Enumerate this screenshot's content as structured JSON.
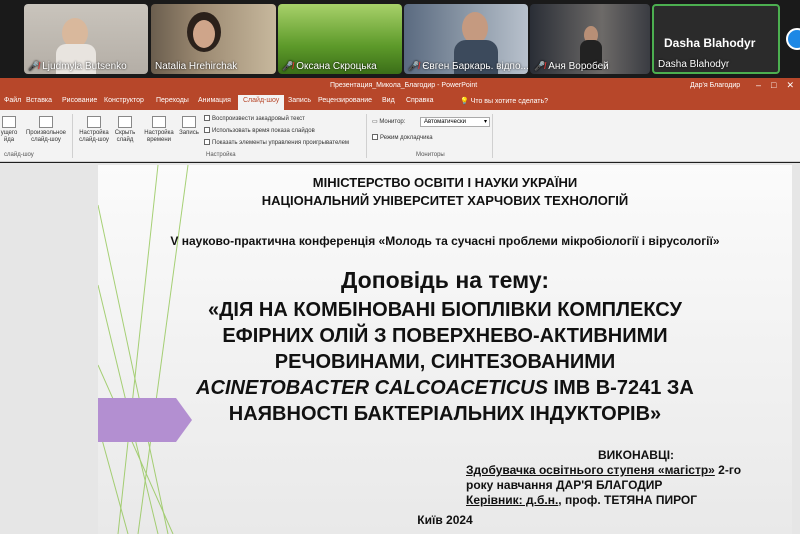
{
  "participants": [
    {
      "name": "Ljudmyla Butsenko",
      "muted": true
    },
    {
      "name": "Natalia Hrehirchak",
      "muted": false
    },
    {
      "name": "Оксана Скроцька",
      "muted": true
    },
    {
      "name": "Євген Баркарь. відпо...",
      "muted": true
    },
    {
      "name": "Аня Воробей",
      "muted": true
    },
    {
      "name": "Dasha Blahodyr",
      "muted": false,
      "display_name": "Dasha Blahodyr"
    }
  ],
  "app": {
    "document_title": "Презентация_Микола_Благодир  -  PowerPoint",
    "user": "Дар'я Благодир"
  },
  "ribbon_tabs": [
    "Файл",
    "Вставка",
    "Рисование",
    "Конструктор",
    "Переходы",
    "Анимация",
    "Слайд-шоу",
    "Запись",
    "Рецензирование",
    "Вид",
    "Справка"
  ],
  "active_tab": "Слайд-шоу",
  "tell_me": "Что вы хотите сделать?",
  "ribbon": {
    "btn_current": "ущего\nйда",
    "btn_custom": "Произвольное\nслайд-шоу",
    "group_start": "слайд-шоу",
    "btn_setup": "Настройка\nслайд-шоу",
    "btn_hide": "Скрыть\nслайд",
    "btn_rehearse": "Настройка\nвремени",
    "btn_record": "Запись",
    "chk_narration": "Воспроизвести закадровый текст",
    "chk_timings": "Использовать время показа слайдов",
    "chk_controls": "Показать элементы управления проигрывателем",
    "group_setup": "Настройка",
    "monitor_label": "Монитор:",
    "monitor_value": "Автоматически",
    "chk_presenter": "Режим докладчика",
    "group_monitors": "Мониторы"
  },
  "slide": {
    "ministry": "МІНІСТЕРСТВО ОСВІТИ І НАУКИ УКРАЇНИ",
    "university": "НАЦІОНАЛЬНИЙ УНІВЕРСИТЕТ ХАРЧОВИХ ТЕХНОЛОГІЙ",
    "conference": "V науково-практична конференція «Молодь та сучасні проблеми мікробіології і вірусології»",
    "report_heading": "Доповідь на тему:",
    "title_line1": "«ДІЯ НА КОМБІНОВАНІ БІОПЛІВКИ КОМПЛЕКСУ",
    "title_line2": "ЕФІРНИХ ОЛІЙ З ПОВЕРХНЕВО-АКТИВНИМИ",
    "title_line3": "РЕЧОВИНАМИ, СИНТЕЗОВАНИМИ",
    "title_line4_italic": "ACINETOBACTER CALCOACETICUS",
    "title_line4_rest": " ІМВ В-7241 ЗА",
    "title_line5": "НАЯВНОСТІ БАКТЕРІАЛЬНИХ ІНДУКТОРІВ»",
    "executors_label": "ВИКОНАВЦІ:",
    "student_line1_u": "Здобувачка освітнього ступеня «магістр»",
    "student_line1_rest": " 2-го",
    "student_line2": "року навчання ДАР'Я БЛАГОДИР",
    "supervisor_u": "Керівник: д.б.н.",
    "supervisor_rest": ", проф. ТЕТЯНА ПИРОГ",
    "city_year": "Київ 2024"
  },
  "colors": {
    "powerpoint_brand": "#b7472a",
    "accent_arrow": "#b38fd1",
    "decor_lines": "#8bc34a",
    "speaker_border": "#4caf50",
    "muted_mic": "#e53935"
  },
  "icons": [
    "mic-muted-icon",
    "minimize-icon",
    "maximize-icon",
    "close-icon",
    "lightbulb-icon"
  ]
}
